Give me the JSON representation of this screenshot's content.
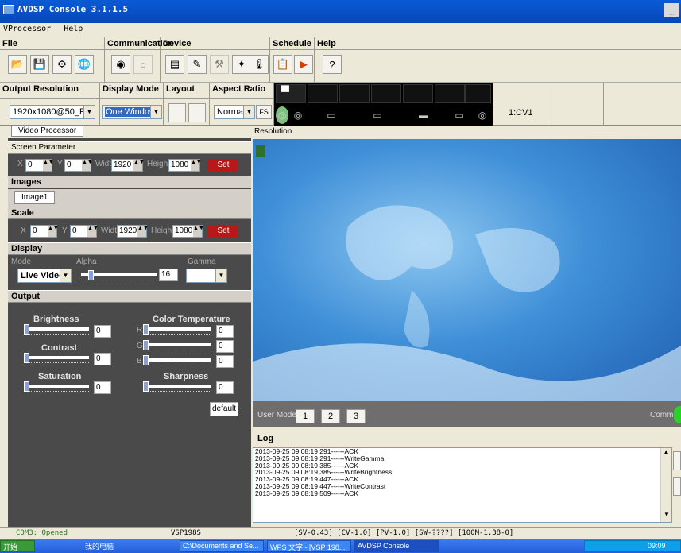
{
  "window": {
    "title": "AVDSP Console 3.1.1.5",
    "minimize": "_ ",
    "maximize": "×"
  },
  "menu": [
    "VProcessor",
    "Help"
  ],
  "toolbar": {
    "groups": [
      "File",
      "Communication",
      "Device",
      "Schedule",
      "Help"
    ]
  },
  "controls": {
    "output_resolution": {
      "label": "Output Resolution",
      "value": "1920x1080@50_P"
    },
    "display_mode": {
      "label": "Display Mode",
      "value": "One Window"
    },
    "layout": {
      "label": "Layout"
    },
    "aspect_ratio": {
      "label": "Aspect Ratio",
      "value": "Normal",
      "fs": "FS"
    },
    "source": "1:CV1"
  },
  "left": {
    "tab": "Video Processor",
    "screen_parameter": {
      "title": "Screen Parameter",
      "x_label": "X",
      "x": "0",
      "y_label": "Y",
      "y": "0",
      "width_label": "Width",
      "width": "1920",
      "height_label": "Height",
      "height": "1080",
      "set": "Set"
    },
    "images": {
      "title": "Images",
      "tab": "Image1"
    },
    "scale": {
      "title": "Scale",
      "x_label": "X",
      "x": "0",
      "y_label": "Y",
      "y": "0",
      "width_label": "Width",
      "width": "1920",
      "height_label": "Height",
      "height": "1080",
      "set": "Set"
    },
    "display": {
      "title": "Display",
      "mode_label": "Mode",
      "mode_value": "Live Video",
      "alpha_label": "Alpha",
      "alpha_value": "16",
      "alpha_level": 0.1,
      "gamma_label": "Gamma",
      "gamma_value": ""
    },
    "output": {
      "title": "Output",
      "brightness": {
        "label": "Brightness",
        "value": "0"
      },
      "contrast": {
        "label": "Contrast",
        "value": "0"
      },
      "saturation": {
        "label": "Saturation",
        "value": "0"
      },
      "color_temperature": {
        "label": "Color Temperature",
        "r_label": "R",
        "r": "0",
        "g_label": "G",
        "g": "0",
        "b_label": "B",
        "b": "0"
      },
      "sharpness": {
        "label": "Sharpness",
        "value": "0"
      },
      "default": "default"
    }
  },
  "right": {
    "resolution_label": "Resolution",
    "user_mode_label": "User Mode",
    "user_modes": [
      "1",
      "2",
      "3"
    ],
    "comm_label": "Comm:",
    "log_title": "Log",
    "log_lines": [
      "2013-09-25 09:08:19 291------ACK",
      "2013-09-25 09:08:19 291------WriteGamma",
      "2013-09-25 09:08:19 385------ACK",
      "2013-09-25 09:08:19 385------WriteBrightness",
      "2013-09-25 09:08:19 447------ACK",
      "2013-09-25 09:08:19 447------WriteContrast",
      "2013-09-25 09:08:19 509------ACK"
    ]
  },
  "status": {
    "com": "COM3: Opened",
    "device": "VSP198S",
    "versions": "[SV-0.43] [CV-1.0] [PV-1.0] [SW-????] [100M-1.38-0]"
  },
  "taskbar": {
    "start": "开始",
    "mycomputer": "我的电脑",
    "task1": "C:\\Documents and Se...",
    "task2": "WPS 文字 - [VSP 198...",
    "task3": "AVDSP Console",
    "time": "09:09"
  }
}
